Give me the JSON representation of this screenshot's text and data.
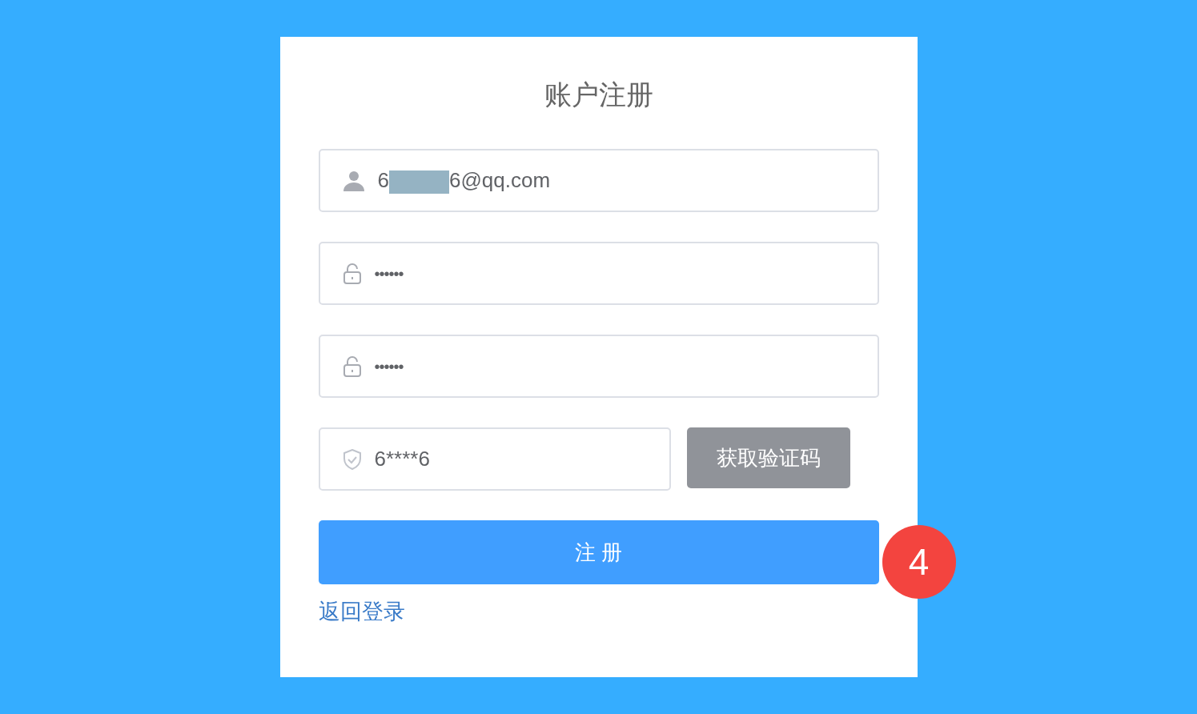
{
  "title": "账户注册",
  "fields": [
    {
      "kind": "user",
      "value_start": "6",
      "redacted": true,
      "value_end": "6@qq.com"
    },
    {
      "kind": "lock",
      "value": "••••••"
    },
    {
      "kind": "lock",
      "value": "••••••"
    },
    {
      "kind": "shield",
      "value": "6****6"
    }
  ],
  "code_button": {
    "label": "获取验证码",
    "disabled": true
  },
  "submit_button": {
    "label": "注 册"
  },
  "back_link": "返回登录",
  "step_badge": "4"
}
